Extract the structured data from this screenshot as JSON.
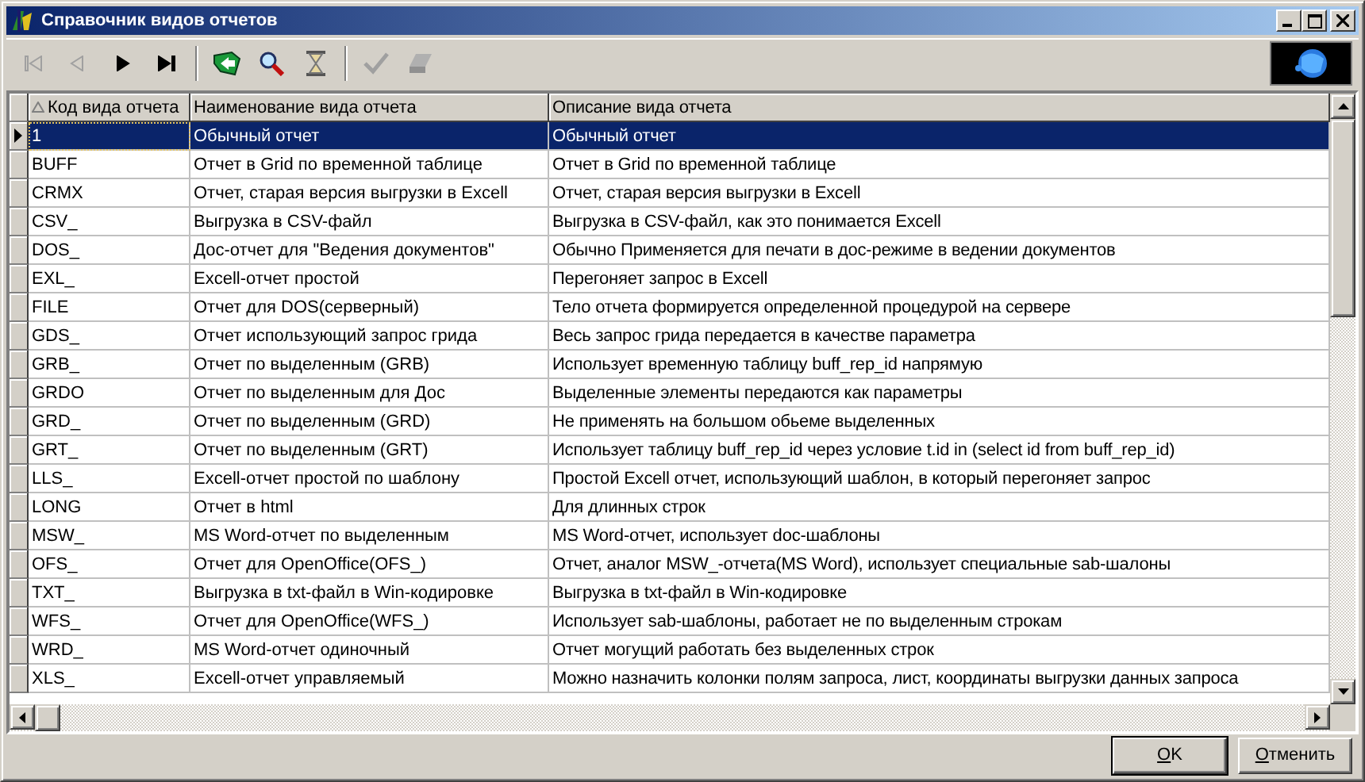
{
  "window": {
    "title": "Справочник видов отчетов"
  },
  "toolbar": [
    {
      "kind": "first",
      "disabled": true
    },
    {
      "kind": "prev",
      "disabled": true
    },
    {
      "kind": "next",
      "disabled": false
    },
    {
      "kind": "last",
      "disabled": false
    },
    {
      "kind": "sep"
    },
    {
      "kind": "refresh",
      "disabled": false
    },
    {
      "kind": "search",
      "disabled": false
    },
    {
      "kind": "hourglass",
      "disabled": false
    },
    {
      "kind": "sep"
    },
    {
      "kind": "check",
      "disabled": true
    },
    {
      "kind": "eraser",
      "disabled": true
    }
  ],
  "table": {
    "columns": [
      {
        "label": "Код вида отчета",
        "sorted": true
      },
      {
        "label": "Наименование вида отчета",
        "sorted": false
      },
      {
        "label": "Описание вида отчета",
        "sorted": false
      }
    ],
    "rows": [
      {
        "code": "1",
        "name": "Обычный отчет",
        "description": "Обычный отчет",
        "selected": true
      },
      {
        "code": "BUFF",
        "name": "Отчет в Grid по временной таблице",
        "description": "Отчет в Grid по временной таблице",
        "selected": false
      },
      {
        "code": "CRMX",
        "name": "Отчет, старая версия выгрузки в Excell",
        "description": "Отчет, старая версия выгрузки в Excell",
        "selected": false
      },
      {
        "code": "CSV_",
        "name": "Выгрузка в CSV-файл",
        "description": "Выгрузка в CSV-файл, как это понимается Excell",
        "selected": false
      },
      {
        "code": "DOS_",
        "name": "Дос-отчет для \"Ведения документов\"",
        "description": "Обычно Применяется для печати в дос-режиме в ведении документов",
        "selected": false
      },
      {
        "code": "EXL_",
        "name": "Excell-отчет простой",
        "description": "Перегоняет запрос в Excell",
        "selected": false
      },
      {
        "code": "FILE",
        "name": "Отчет для DOS(серверный)",
        "description": "Тело отчета формируется определенной процедурой на сервере",
        "selected": false
      },
      {
        "code": "GDS_",
        "name": "Отчет использующий запрос грида",
        "description": "Весь запрос грида передается в качестве параметра",
        "selected": false
      },
      {
        "code": "GRB_",
        "name": "Отчет по выделенным (GRB)",
        "description": "Использует временную таблицу buff_rep_id напрямую",
        "selected": false
      },
      {
        "code": "GRDO",
        "name": "Отчет по выделенным для Дос",
        "description": "Выделенные элементы передаются как параметры",
        "selected": false
      },
      {
        "code": "GRD_",
        "name": "Отчет по выделенным (GRD)",
        "description": "Не применять на большом обьеме выделенных",
        "selected": false
      },
      {
        "code": "GRT_",
        "name": "Отчет по выделенным (GRT)",
        "description": "Использует таблицу buff_rep_id через условие t.id in (select id from buff_rep_id)",
        "selected": false
      },
      {
        "code": "LLS_",
        "name": "Excell-отчет простой по шаблону",
        "description": "Простой Excell отчет, использующий шаблон, в который перегоняет запрос",
        "selected": false
      },
      {
        "code": "LONG",
        "name": "Отчет в html",
        "description": "Для длинных строк",
        "selected": false
      },
      {
        "code": "MSW_",
        "name": "MS Word-отчет по выделенным",
        "description": "MS Word-отчет, использует doc-шаблоны",
        "selected": false
      },
      {
        "code": "OFS_",
        "name": "Отчет для OpenOffice(OFS_)",
        "description": "Отчет, аналог MSW_-отчета(MS Word), использует специальные sab-шалоны",
        "selected": false
      },
      {
        "code": "TXT_",
        "name": "Выгрузка в txt-файл в Win-кодировке",
        "description": "Выгрузка в txt-файл в Win-кодировке",
        "selected": false
      },
      {
        "code": "WFS_",
        "name": "Отчет для OpenOffice(WFS_)",
        "description": "Использует sab-шаблоны, работает не по выделенным строкам",
        "selected": false
      },
      {
        "code": "WRD_",
        "name": "MS Word-отчет одиночный",
        "description": "Отчет могущий работать без выделенных строк",
        "selected": false
      },
      {
        "code": "XLS_",
        "name": "Excell-отчет управляемый",
        "description": "Можно назначить колонки полям запроса, лист, координаты выгрузки данных запроса",
        "selected": false
      }
    ]
  },
  "buttons": [
    "OK",
    "Отменить"
  ]
}
